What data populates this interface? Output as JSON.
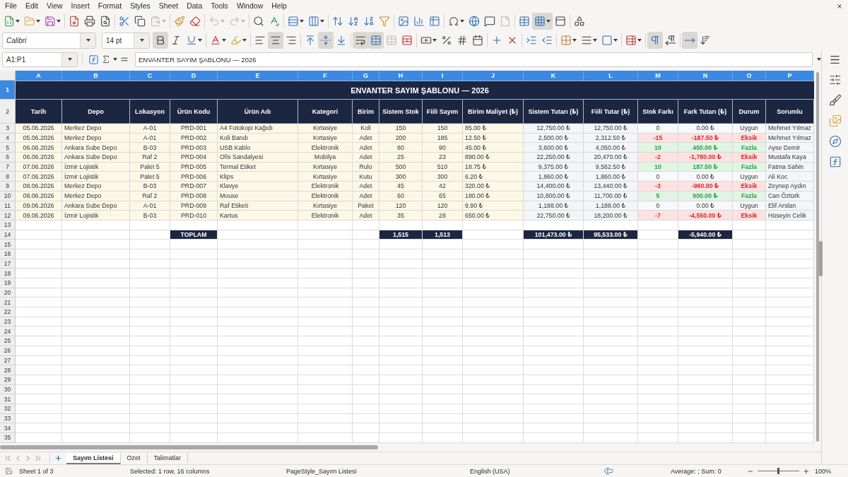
{
  "menu_bar": [
    "File",
    "Edit",
    "View",
    "Insert",
    "Format",
    "Styles",
    "Sheet",
    "Data",
    "Tools",
    "Window",
    "Help"
  ],
  "standard_toolbar": [
    [
      {
        "kind": "new",
        "dropdown": true,
        "pressed": false,
        "disabled": false
      },
      {
        "kind": "open",
        "dropdown": true,
        "pressed": false,
        "disabled": false
      },
      {
        "kind": "save",
        "dropdown": true,
        "pressed": false,
        "disabled": false
      }
    ],
    [
      {
        "kind": "export-pdf",
        "dropdown": false,
        "pressed": false,
        "disabled": false
      },
      {
        "kind": "print",
        "dropdown": false,
        "pressed": false,
        "disabled": false
      },
      {
        "kind": "print-preview",
        "dropdown": false,
        "pressed": false,
        "disabled": false
      }
    ],
    [
      {
        "kind": "cut",
        "dropdown": false,
        "pressed": false,
        "disabled": false
      },
      {
        "kind": "copy",
        "dropdown": false,
        "pressed": false,
        "disabled": false
      },
      {
        "kind": "paste",
        "dropdown": true,
        "pressed": false,
        "disabled": true
      }
    ],
    [
      {
        "kind": "clone-formatting",
        "dropdown": false,
        "pressed": false,
        "disabled": false
      },
      {
        "kind": "clear-formatting",
        "dropdown": false,
        "pressed": false,
        "disabled": false
      }
    ],
    [
      {
        "kind": "undo",
        "dropdown": true,
        "pressed": false,
        "disabled": true
      },
      {
        "kind": "redo",
        "dropdown": true,
        "pressed": false,
        "disabled": true
      }
    ],
    [
      {
        "kind": "find-replace",
        "dropdown": false,
        "pressed": false,
        "disabled": false
      },
      {
        "kind": "spelling",
        "dropdown": false,
        "pressed": false,
        "disabled": false
      }
    ],
    [
      {
        "kind": "row",
        "dropdown": true,
        "pressed": false,
        "disabled": false
      },
      {
        "kind": "column",
        "dropdown": true,
        "pressed": false,
        "disabled": false
      }
    ],
    [
      {
        "kind": "sort",
        "dropdown": false,
        "pressed": false,
        "disabled": false
      },
      {
        "kind": "sort-ascending",
        "dropdown": false,
        "pressed": false,
        "disabled": false
      },
      {
        "kind": "sort-descending",
        "dropdown": false,
        "pressed": false,
        "disabled": false
      },
      {
        "kind": "autofilter",
        "dropdown": false,
        "pressed": false,
        "disabled": false
      }
    ],
    [
      {
        "kind": "image",
        "dropdown": false,
        "pressed": false,
        "disabled": false
      },
      {
        "kind": "chart",
        "dropdown": false,
        "pressed": false,
        "disabled": false
      },
      {
        "kind": "pivot-table",
        "dropdown": false,
        "pressed": false,
        "disabled": false
      }
    ],
    [
      {
        "kind": "special-character",
        "dropdown": true,
        "pressed": false,
        "disabled": false
      },
      {
        "kind": "hyperlink",
        "dropdown": false,
        "pressed": false,
        "disabled": false
      },
      {
        "kind": "comment",
        "dropdown": false,
        "pressed": false,
        "disabled": false
      },
      {
        "kind": "headers-footers",
        "dropdown": false,
        "pressed": false,
        "disabled": true
      }
    ],
    [
      {
        "kind": "print-area",
        "dropdown": false,
        "pressed": false,
        "disabled": false
      },
      {
        "kind": "freeze",
        "dropdown": true,
        "pressed": true,
        "disabled": false
      },
      {
        "kind": "split-window",
        "dropdown": false,
        "pressed": false,
        "disabled": false
      }
    ],
    [
      {
        "kind": "shapes",
        "dropdown": false,
        "pressed": false,
        "disabled": false
      }
    ]
  ],
  "formatting_toolbar": {
    "font_name": "Calibri",
    "font_size": "14 pt",
    "groups": [
      [
        {
          "kind": "bold",
          "dropdown": false,
          "pressed": true,
          "disabled": false
        },
        {
          "kind": "italic",
          "dropdown": false,
          "pressed": false,
          "disabled": false
        },
        {
          "kind": "underline",
          "dropdown": true,
          "pressed": false,
          "disabled": false
        }
      ],
      [
        {
          "kind": "font-color",
          "dropdown": true,
          "pressed": false,
          "disabled": false
        },
        {
          "kind": "highlight",
          "dropdown": true,
          "pressed": false,
          "disabled": false
        }
      ],
      [
        {
          "kind": "align-left",
          "dropdown": false,
          "pressed": false,
          "disabled": false
        },
        {
          "kind": "align-center",
          "dropdown": false,
          "pressed": true,
          "disabled": false
        },
        {
          "kind": "align-right",
          "dropdown": false,
          "pressed": false,
          "disabled": false
        }
      ],
      [
        {
          "kind": "align-top",
          "dropdown": false,
          "pressed": false,
          "disabled": false
        },
        {
          "kind": "align-middle",
          "dropdown": false,
          "pressed": true,
          "disabled": false
        },
        {
          "kind": "align-bottom",
          "dropdown": false,
          "pressed": false,
          "disabled": false
        }
      ],
      [
        {
          "kind": "wrap",
          "dropdown": false,
          "pressed": true,
          "disabled": false
        },
        {
          "kind": "merge-center",
          "dropdown": false,
          "pressed": true,
          "disabled": false
        },
        {
          "kind": "merge",
          "dropdown": false,
          "pressed": false,
          "disabled": true
        },
        {
          "kind": "unmerge",
          "dropdown": false,
          "pressed": false,
          "disabled": false
        }
      ],
      [
        {
          "kind": "currency",
          "dropdown": true,
          "pressed": false,
          "disabled": false
        },
        {
          "kind": "percent",
          "dropdown": false,
          "pressed": false,
          "disabled": false
        },
        {
          "kind": "number",
          "dropdown": false,
          "pressed": false,
          "disabled": false
        },
        {
          "kind": "date",
          "dropdown": false,
          "pressed": false,
          "disabled": false
        }
      ],
      [
        {
          "kind": "add-decimal",
          "dropdown": false,
          "pressed": false,
          "disabled": false
        },
        {
          "kind": "delete-decimal",
          "dropdown": false,
          "pressed": false,
          "disabled": false
        }
      ],
      [
        {
          "kind": "indent-increase",
          "dropdown": false,
          "pressed": false,
          "disabled": false
        },
        {
          "kind": "indent-decrease",
          "dropdown": false,
          "pressed": false,
          "disabled": false
        }
      ],
      [
        {
          "kind": "borders",
          "dropdown": true,
          "pressed": false,
          "disabled": false
        },
        {
          "kind": "border-style",
          "dropdown": true,
          "pressed": false,
          "disabled": false
        },
        {
          "kind": "border-color",
          "dropdown": true,
          "pressed": false,
          "disabled": false
        }
      ],
      [
        {
          "kind": "conditional",
          "dropdown": true,
          "pressed": false,
          "disabled": false
        }
      ],
      [
        {
          "kind": "left-to-right",
          "dropdown": false,
          "pressed": true,
          "disabled": false
        },
        {
          "kind": "right-to-left",
          "dropdown": false,
          "pressed": false,
          "disabled": false
        }
      ],
      [
        {
          "kind": "text-horizontal",
          "dropdown": false,
          "pressed": true,
          "disabled": false
        },
        {
          "kind": "text-vertical",
          "dropdown": false,
          "pressed": false,
          "disabled": false
        }
      ]
    ]
  },
  "formula_bar": {
    "name_box": "A1:P1",
    "content": "ENVANTER SAYIM ŞABLONU — 2026"
  },
  "sheet": {
    "columns": [
      {
        "label": "A",
        "selected": true
      },
      {
        "label": "B",
        "selected": true
      },
      {
        "label": "C",
        "selected": true
      },
      {
        "label": "D",
        "selected": true
      },
      {
        "label": "E",
        "selected": true
      },
      {
        "label": "F",
        "selected": true
      },
      {
        "label": "G",
        "selected": true
      },
      {
        "label": "H",
        "selected": true
      },
      {
        "label": "I",
        "selected": true
      },
      {
        "label": "J",
        "selected": true
      },
      {
        "label": "K",
        "selected": true
      },
      {
        "label": "L",
        "selected": true
      },
      {
        "label": "M",
        "selected": true
      },
      {
        "label": "N",
        "selected": true
      },
      {
        "label": "O",
        "selected": true
      },
      {
        "label": "P",
        "selected": true
      }
    ],
    "rows": [
      {
        "number": "1",
        "selected": true,
        "kind": "title",
        "text": "ENVANTER SAYIM ŞABLONU — 2026"
      },
      {
        "number": "2",
        "selected": false,
        "kind": "header",
        "cells": [
          "Tarih",
          "Depo",
          "Lokasyon",
          "Ürün Kodu",
          "Ürün Adı",
          "Kategori",
          "Birim",
          "Sistem Stok",
          "Fiili Sayım",
          "Birim Maliyet (₺)",
          "Sistem Tutarı (₺)",
          "Fiili Tutar (₺)",
          "Stok Farkı",
          "Fark Tutarı (₺)",
          "Durum",
          "Sorumlu"
        ]
      },
      {
        "number": "3",
        "selected": false,
        "kind": "match",
        "cells": [
          "05.06.2026",
          "Merkez Depo",
          "A-01",
          "PRD-001",
          "A4 Fotokopi Kağıdı",
          "Kırtasiye",
          "Koli",
          "150",
          "150",
          "85.00 ₺",
          "12,750.00 ₺",
          "12,750.00 ₺",
          "0",
          "0.00 ₺",
          "Uygun",
          "Mehmet Yılmaz"
        ]
      },
      {
        "number": "4",
        "selected": false,
        "kind": "short",
        "cells": [
          "05.06.2026",
          "Merkez Depo",
          "A-01",
          "PRD-002",
          "Koli Bandı",
          "Kırtasiye",
          "Adet",
          "200",
          "185",
          "12.50 ₺",
          "2,500.00 ₺",
          "2,312.50 ₺",
          "-15",
          "-187.50 ₺",
          "Eksik",
          "Mehmet Yılmaz"
        ]
      },
      {
        "number": "5",
        "selected": false,
        "kind": "over",
        "cells": [
          "06.06.2026",
          "Ankara Sube Depo",
          "B-03",
          "PRD-003",
          "USB Kablo",
          "Elektronik",
          "Adet",
          "80",
          "90",
          "45.00 ₺",
          "3,600.00 ₺",
          "4,050.00 ₺",
          "10",
          "450.00 ₺",
          "Fazla",
          "Ayse Demir"
        ]
      },
      {
        "number": "6",
        "selected": false,
        "kind": "short",
        "cells": [
          "06.06.2026",
          "Ankara Sube Depo",
          "Raf 2",
          "PRD-004",
          "Ofis Sandalyesi",
          "Mobilya",
          "Adet",
          "25",
          "23",
          "890.00 ₺",
          "22,250.00 ₺",
          "20,470.00 ₺",
          "-2",
          "-1,780.00 ₺",
          "Eksik",
          "Mustafa Kaya"
        ]
      },
      {
        "number": "7",
        "selected": false,
        "kind": "over",
        "cells": [
          "07.06.2026",
          "İzmir Lojistik",
          "Palet 5",
          "PRD-005",
          "Termal Etiket",
          "Kırtasiye",
          "Rulo",
          "500",
          "510",
          "18.75 ₺",
          "9,375.00 ₺",
          "9,562.50 ₺",
          "10",
          "187.50 ₺",
          "Fazla",
          "Fatma Sahin"
        ]
      },
      {
        "number": "8",
        "selected": false,
        "kind": "match",
        "cells": [
          "07.06.2026",
          "İzmir Lojistik",
          "Palet 5",
          "PRD-006",
          "Klips",
          "Kırtasiye",
          "Kutu",
          "300",
          "300",
          "6.20 ₺",
          "1,860.00 ₺",
          "1,860.00 ₺",
          "0",
          "0.00 ₺",
          "Uygun",
          "Ali Koc"
        ]
      },
      {
        "number": "9",
        "selected": false,
        "kind": "short",
        "cells": [
          "08.06.2026",
          "Merkez Depo",
          "B-03",
          "PRD-007",
          "Klavye",
          "Elektronik",
          "Adet",
          "45",
          "42",
          "320.00 ₺",
          "14,400.00 ₺",
          "13,440.00 ₺",
          "-3",
          "-960.00 ₺",
          "Eksik",
          "Zeynep Aydın"
        ]
      },
      {
        "number": "10",
        "selected": false,
        "kind": "over",
        "cells": [
          "08.06.2026",
          "Merkez Depo",
          "Raf 2",
          "PRD-008",
          "Mouse",
          "Elektronik",
          "Adet",
          "60",
          "65",
          "180.00 ₺",
          "10,800.00 ₺",
          "11,700.00 ₺",
          "5",
          "900.00 ₺",
          "Fazla",
          "Can Öztürk"
        ]
      },
      {
        "number": "11",
        "selected": false,
        "kind": "match",
        "cells": [
          "09.06.2026",
          "Ankara Sube Depo",
          "A-01",
          "PRD-009",
          "Raf Etiketi",
          "Kırtasiye",
          "Paket",
          "120",
          "120",
          "9.90 ₺",
          "1,188.00 ₺",
          "1,188.00 ₺",
          "0",
          "0.00 ₺",
          "Uygun",
          "Elif Arslan"
        ]
      },
      {
        "number": "12",
        "selected": false,
        "kind": "short",
        "cells": [
          "09.06.2026",
          "İzmir Lojistik",
          "B-03",
          "PRD-010",
          "Kartus",
          "Elektronik",
          "Adet",
          "35",
          "28",
          "650.00 ₺",
          "22,750.00 ₺",
          "18,200.00 ₺",
          "-7",
          "-4,550.00 ₺",
          "Eksik",
          "Hüseyin Celik"
        ]
      },
      {
        "number": "13",
        "selected": false,
        "kind": "blank"
      },
      {
        "number": "14",
        "selected": false,
        "kind": "total",
        "label": "TOPLAM",
        "system_stock": "1,515",
        "counted": "1,513",
        "system_value": "101,473.00 ₺",
        "counted_value": "95,533.00 ₺",
        "difference_value": "-5,940.00 ₺"
      },
      {
        "number": "15",
        "selected": false,
        "kind": "blank"
      },
      {
        "number": "16",
        "selected": false,
        "kind": "blank"
      },
      {
        "number": "17",
        "selected": false,
        "kind": "blank"
      },
      {
        "number": "18",
        "selected": false,
        "kind": "blank"
      },
      {
        "number": "19",
        "selected": false,
        "kind": "blank"
      },
      {
        "number": "20",
        "selected": false,
        "kind": "blank"
      },
      {
        "number": "21",
        "selected": false,
        "kind": "blank"
      },
      {
        "number": "22",
        "selected": false,
        "kind": "blank"
      },
      {
        "number": "23",
        "selected": false,
        "kind": "blank"
      },
      {
        "number": "24",
        "selected": false,
        "kind": "blank"
      },
      {
        "number": "25",
        "selected": false,
        "kind": "blank"
      },
      {
        "number": "26",
        "selected": false,
        "kind": "blank"
      },
      {
        "number": "27",
        "selected": false,
        "kind": "blank"
      },
      {
        "number": "28",
        "selected": false,
        "kind": "blank"
      },
      {
        "number": "29",
        "selected": false,
        "kind": "blank"
      },
      {
        "number": "30",
        "selected": false,
        "kind": "blank"
      },
      {
        "number": "31",
        "selected": false,
        "kind": "blank"
      },
      {
        "number": "32",
        "selected": false,
        "kind": "blank"
      },
      {
        "number": "33",
        "selected": false,
        "kind": "blank"
      },
      {
        "number": "34",
        "selected": false,
        "kind": "blank"
      },
      {
        "number": "35",
        "selected": false,
        "kind": "blank"
      }
    ]
  },
  "sheet_tabs": [
    {
      "label": "Sayım Listesi",
      "selected": true
    },
    {
      "label": "Ozet",
      "selected": false
    },
    {
      "label": "Talimatlar",
      "selected": false
    }
  ],
  "status_bar": {
    "sheet": "Sheet 1 of 3",
    "selection": "Selected: 1 row, 16 columns",
    "page_style": "PageStyle_Sayım Listesi",
    "language": "English (USA)",
    "summary": "Average: ; Sum: 0",
    "zoom": {
      "level": 0.5,
      "text": "100%"
    }
  }
}
